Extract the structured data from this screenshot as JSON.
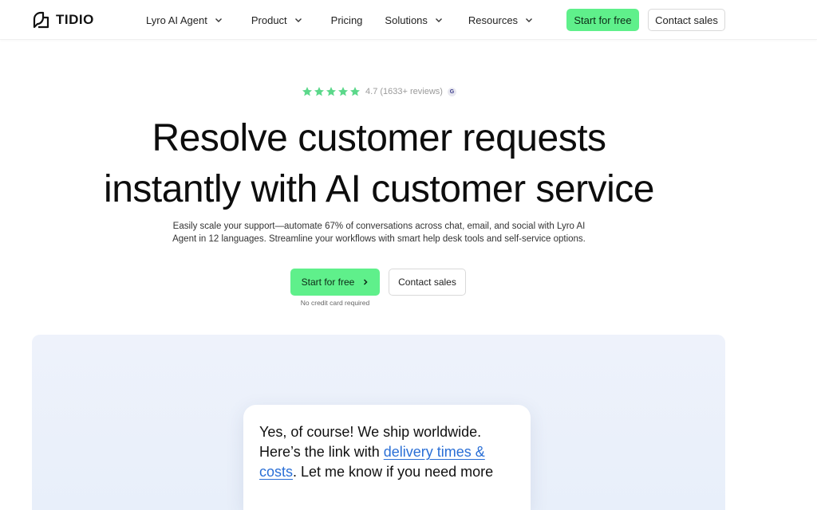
{
  "brand": {
    "name": "TIDIO"
  },
  "nav": {
    "items": [
      {
        "label": "Lyro AI Agent",
        "dropdown": true
      },
      {
        "label": "Product",
        "dropdown": true
      },
      {
        "label": "Pricing",
        "dropdown": false
      },
      {
        "label": "Solutions",
        "dropdown": true
      },
      {
        "label": "Resources",
        "dropdown": true
      }
    ],
    "start_label": "Start for free",
    "contact_label": "Contact sales"
  },
  "hero": {
    "rating_text": "4.7 (1633+ reviews)",
    "headline_line1": "Resolve customer requests",
    "headline_line2": "instantly with AI customer service",
    "subtext": "Easily scale your support—automate 67% of conversations across chat, email, and social with Lyro AI Agent in 12 languages. Streamline your workflows with smart help desk tools and self-service options.",
    "cta_start_label": "Start for free",
    "cta_contact_label": "Contact sales",
    "no_card_note": "No credit card required"
  },
  "demo": {
    "chat_part1": "Yes, of course! We ship worldwide. Here’s the link with ",
    "chat_link": "delivery times & costs",
    "chat_part2": ". Let me know if you need more"
  },
  "colors": {
    "accent_green": "#5ff08b",
    "link_blue": "#2a6fd6",
    "panel_bg": "#eef2fb"
  }
}
